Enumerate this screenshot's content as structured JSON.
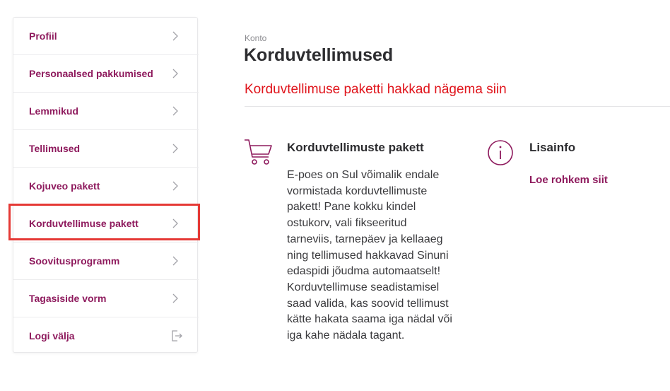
{
  "sidebar": {
    "items": [
      {
        "label": "Profiil",
        "icon": "chevron-right-icon"
      },
      {
        "label": "Personaalsed pakkumised",
        "icon": "chevron-right-icon"
      },
      {
        "label": "Lemmikud",
        "icon": "chevron-right-icon"
      },
      {
        "label": "Tellimused",
        "icon": "chevron-right-icon"
      },
      {
        "label": "Kojuveo pakett",
        "icon": "chevron-right-icon"
      },
      {
        "label": "Korduvtellimuse pakett",
        "icon": "chevron-right-icon",
        "highlighted": true
      },
      {
        "label": "Soovitusprogramm",
        "icon": "chevron-right-icon"
      },
      {
        "label": "Tagasiside vorm",
        "icon": "chevron-right-icon"
      },
      {
        "label": "Logi välja",
        "icon": "logout-icon"
      }
    ]
  },
  "main": {
    "breadcrumb": "Konto",
    "title": "Korduvtellimused",
    "notice": "Korduvtellimuse paketti hakkad nägema siin",
    "package": {
      "icon": "shopping-cart-icon",
      "title": "Korduvtellimuste pakett",
      "description": "E-poes on Sul võimalik endale vormistada korduvtellimuste pakett! Pane kokku kindel ostukorv, vali fikseeritud tarneviis, tarnepäev ja kellaaeg ning tellimused hakkavad Sinuni edaspidi jõudma automaatselt! Korduvtellimuse seadistamisel saad valida, kas soovid tellimust kätte hakata saama iga nädal või iga kahe nädala tagant."
    },
    "info": {
      "icon": "info-icon",
      "title": "Lisainfo",
      "link": "Loe rohkem siit"
    }
  },
  "colors": {
    "brand": "#8e1a5d",
    "notice": "#e0151c",
    "highlight": "#e53935",
    "text": "#2d2d30"
  }
}
